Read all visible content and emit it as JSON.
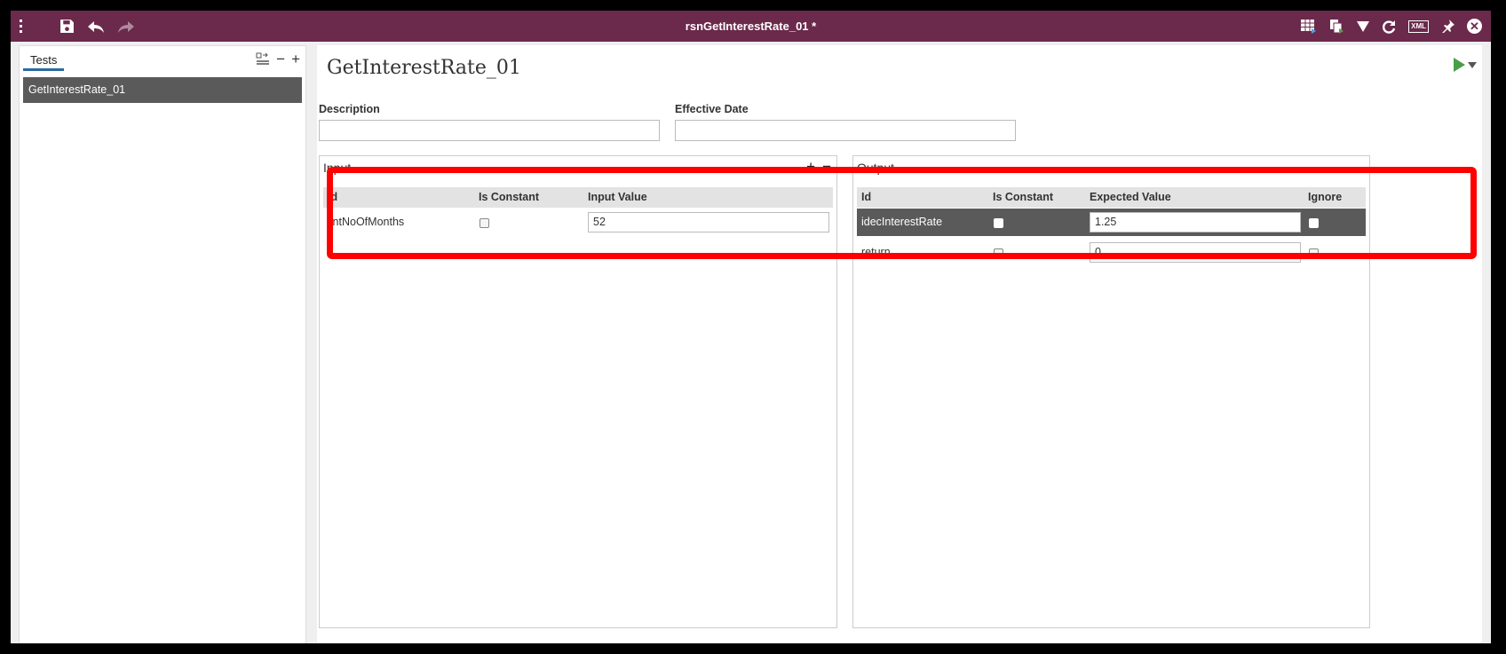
{
  "window": {
    "title": "rsnGetInterestRate_01 *",
    "accent": "#6b294b"
  },
  "toolbar_left": [
    "menu-icon",
    "save-icon",
    "undo-icon",
    "redo-icon"
  ],
  "toolbar_right": {
    "icons": [
      "grid-icon",
      "copy-icon",
      "filter-icon",
      "refresh-icon",
      "xml-icon",
      "pin-icon",
      "close-icon"
    ],
    "xml_label": "XML"
  },
  "sidebar": {
    "tab_label": "Tests",
    "items": [
      {
        "label": "GetInterestRate_01"
      }
    ]
  },
  "main": {
    "title": "GetInterestRate_01",
    "description_label": "Description",
    "description_value": "",
    "effective_date_label": "Effective Date",
    "effective_date_value": ""
  },
  "input_panel": {
    "title": "Input",
    "columns": [
      "Id",
      "Is Constant",
      "Input Value"
    ],
    "rows": [
      {
        "id": "iintNoOfMonths",
        "is_constant": false,
        "value": "52"
      }
    ]
  },
  "output_panel": {
    "title": "Output",
    "columns": [
      "Id",
      "Is Constant",
      "Expected Value",
      "Ignore"
    ],
    "rows": [
      {
        "id": "idecInterestRate",
        "is_constant": false,
        "value": "1.25",
        "ignore": false,
        "selected": true
      },
      {
        "id": "return",
        "is_constant": false,
        "value": "0",
        "ignore": false,
        "selected": false
      }
    ]
  },
  "highlight_color": "#ff0000"
}
